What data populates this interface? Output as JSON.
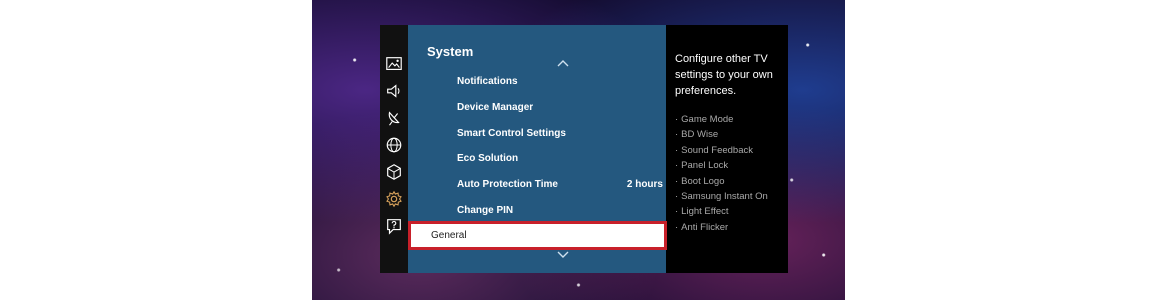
{
  "menu": {
    "title": "System",
    "items": [
      {
        "label": "Notifications",
        "value": ""
      },
      {
        "label": "Device Manager",
        "value": ""
      },
      {
        "label": "Smart Control Settings",
        "value": ""
      },
      {
        "label": "Eco Solution",
        "value": ""
      },
      {
        "label": "Auto Protection Time",
        "value": "2 hours"
      },
      {
        "label": "Change PIN",
        "value": ""
      },
      {
        "label": "General",
        "value": ""
      }
    ],
    "selected_index": 6
  },
  "rail_icons": [
    "picture-icon",
    "sound-icon",
    "broadcasting-icon",
    "network-icon",
    "system-box-icon",
    "settings-gear-icon",
    "support-icon"
  ],
  "side": {
    "description": "Configure other TV settings to your own preferences.",
    "bullet": "·",
    "items": [
      "Game Mode",
      "BD Wise",
      "Sound Feedback",
      "Panel Lock",
      "Boot Logo",
      "Samsung Instant On",
      "Light Effect",
      "Anti Flicker"
    ]
  },
  "colors": {
    "panel_blue": "#24587f",
    "highlight_border": "#c8202a",
    "active_icon": "#d9a35c"
  }
}
